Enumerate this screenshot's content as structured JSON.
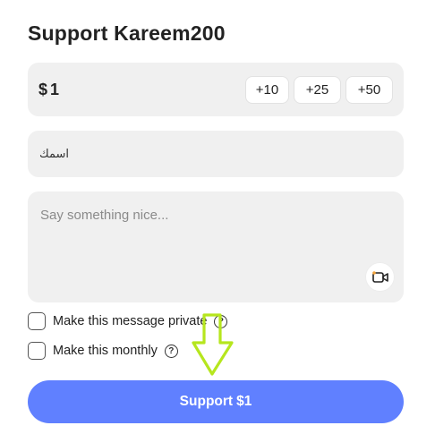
{
  "title": "Support Kareem200",
  "amount": {
    "currency": "$",
    "value": "1",
    "increments": [
      "+10",
      "+25",
      "+50"
    ]
  },
  "name_field": {
    "value": "اسمك"
  },
  "message_field": {
    "placeholder": "Say something nice..."
  },
  "icons": {
    "video": "video-camera-icon",
    "help": "question-circle-icon",
    "arrow": "down-arrow-annotation-icon"
  },
  "options": {
    "private_label": "Make this message private",
    "monthly_label": "Make this monthly",
    "help_glyph": "?"
  },
  "support_button": {
    "label": "Support",
    "amount": "$1"
  },
  "colors": {
    "accent": "#6080ff",
    "field_bg": "#f0f0f0",
    "arrow": "#b6e61e"
  }
}
